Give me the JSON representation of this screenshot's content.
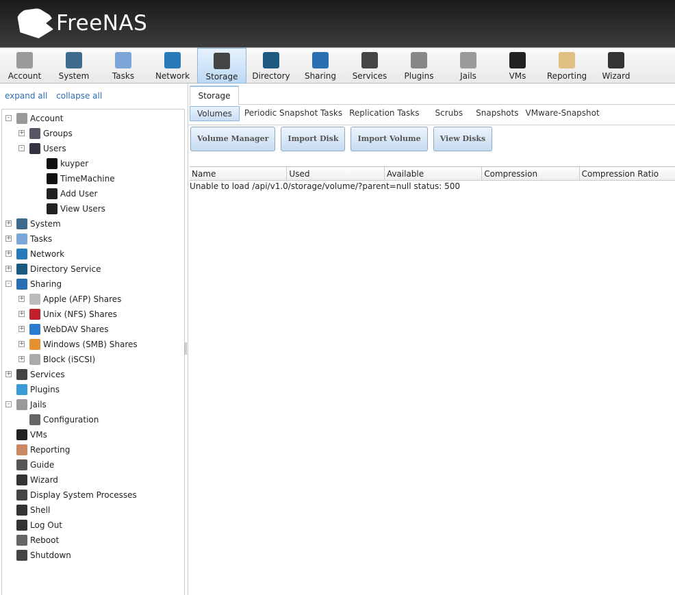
{
  "brand": {
    "name": "FreeNAS"
  },
  "topnav": [
    {
      "label": "Account",
      "icon": "account-icon",
      "color": "#9a9a9a"
    },
    {
      "label": "System",
      "icon": "system-icon",
      "color": "#3e6b8c"
    },
    {
      "label": "Tasks",
      "icon": "tasks-icon",
      "color": "#7aa6d8"
    },
    {
      "label": "Network",
      "icon": "network-icon",
      "color": "#2b7ab8"
    },
    {
      "label": "Storage",
      "icon": "storage-icon",
      "color": "#444444",
      "active": true
    },
    {
      "label": "Directory",
      "icon": "directory-icon",
      "color": "#1e5a80"
    },
    {
      "label": "Sharing",
      "icon": "sharing-icon",
      "color": "#2a6fb0"
    },
    {
      "label": "Services",
      "icon": "services-icon",
      "color": "#444444"
    },
    {
      "label": "Plugins",
      "icon": "plugins-icon",
      "color": "#888888"
    },
    {
      "label": "Jails",
      "icon": "jails-icon",
      "color": "#999999"
    },
    {
      "label": "VMs",
      "icon": "vms-icon",
      "color": "#222222"
    },
    {
      "label": "Reporting",
      "icon": "reporting-icon",
      "color": "#e0c080"
    },
    {
      "label": "Wizard",
      "icon": "wizard-icon",
      "color": "#333333"
    }
  ],
  "sidebar": {
    "expand_all": "expand all",
    "collapse_all": "collapse all",
    "tree": [
      {
        "label": "Account",
        "level": 0,
        "exp": "-",
        "icon": "account-icon",
        "color": "#999"
      },
      {
        "label": "Groups",
        "level": 1,
        "exp": "+",
        "icon": "groups-icon",
        "color": "#556"
      },
      {
        "label": "Users",
        "level": 1,
        "exp": "-",
        "icon": "users-icon",
        "color": "#334"
      },
      {
        "label": "kuyper",
        "level": 2,
        "icon": "user-icon",
        "color": "#111"
      },
      {
        "label": "TimeMachine",
        "level": 2,
        "icon": "user-icon",
        "color": "#111"
      },
      {
        "label": "Add User",
        "level": 2,
        "icon": "add-user-icon",
        "color": "#222"
      },
      {
        "label": "View Users",
        "level": 2,
        "icon": "view-users-icon",
        "color": "#222"
      },
      {
        "label": "System",
        "level": 0,
        "exp": "+",
        "icon": "system-icon",
        "color": "#3e6b8c"
      },
      {
        "label": "Tasks",
        "level": 0,
        "exp": "+",
        "icon": "tasks-icon",
        "color": "#7aa6d8"
      },
      {
        "label": "Network",
        "level": 0,
        "exp": "+",
        "icon": "network-icon",
        "color": "#2b7ab8"
      },
      {
        "label": "Directory Service",
        "level": 0,
        "exp": "+",
        "icon": "directory-icon",
        "color": "#1e5a80"
      },
      {
        "label": "Sharing",
        "level": 0,
        "exp": "-",
        "icon": "sharing-icon",
        "color": "#2a6fb0"
      },
      {
        "label": "Apple (AFP) Shares",
        "level": 1,
        "exp": "+",
        "icon": "apple-icon",
        "color": "#bbb"
      },
      {
        "label": "Unix (NFS) Shares",
        "level": 1,
        "exp": "+",
        "icon": "nfs-icon",
        "color": "#c0202a"
      },
      {
        "label": "WebDAV Shares",
        "level": 1,
        "exp": "+",
        "icon": "webdav-icon",
        "color": "#2a7ad0"
      },
      {
        "label": "Windows (SMB) Shares",
        "level": 1,
        "exp": "+",
        "icon": "windows-icon",
        "color": "#e89030"
      },
      {
        "label": "Block (iSCSI)",
        "level": 1,
        "exp": "+",
        "icon": "block-icon",
        "color": "#aaa"
      },
      {
        "label": "Services",
        "level": 0,
        "exp": "+",
        "icon": "services-icon",
        "color": "#444"
      },
      {
        "label": "Plugins",
        "level": 0,
        "icon": "plugins-icon",
        "color": "#3a9ad8"
      },
      {
        "label": "Jails",
        "level": 0,
        "exp": "-",
        "icon": "jails-icon",
        "color": "#999"
      },
      {
        "label": "Configuration",
        "level": 1,
        "icon": "wrench-icon",
        "color": "#666"
      },
      {
        "label": "VMs",
        "level": 0,
        "icon": "vms-icon",
        "color": "#222"
      },
      {
        "label": "Reporting",
        "level": 0,
        "icon": "reporting-icon",
        "color": "#c86"
      },
      {
        "label": "Guide",
        "level": 0,
        "icon": "guide-icon",
        "color": "#555"
      },
      {
        "label": "Wizard",
        "level": 0,
        "icon": "wizard-icon",
        "color": "#333"
      },
      {
        "label": "Display System Processes",
        "level": 0,
        "icon": "processes-icon",
        "color": "#444"
      },
      {
        "label": "Shell",
        "level": 0,
        "icon": "shell-icon",
        "color": "#333"
      },
      {
        "label": "Log Out",
        "level": 0,
        "icon": "logout-icon",
        "color": "#333"
      },
      {
        "label": "Reboot",
        "level": 0,
        "icon": "reboot-icon",
        "color": "#666"
      },
      {
        "label": "Shutdown",
        "level": 0,
        "icon": "shutdown-icon",
        "color": "#444"
      }
    ]
  },
  "main": {
    "tab": "Storage",
    "subtabs": [
      "Volumes",
      "Periodic Snapshot Tasks",
      "Replication Tasks",
      "Scrubs",
      "Snapshots",
      "VMware-Snapshot"
    ],
    "buttons": [
      "Volume Manager",
      "Import Disk",
      "Import Volume",
      "View Disks"
    ],
    "columns": [
      "Name",
      "Used",
      "Available",
      "Compression",
      "Compression Ratio"
    ],
    "message": "Unable to load /api/v1.0/storage/volume/?parent=null status: 500"
  }
}
